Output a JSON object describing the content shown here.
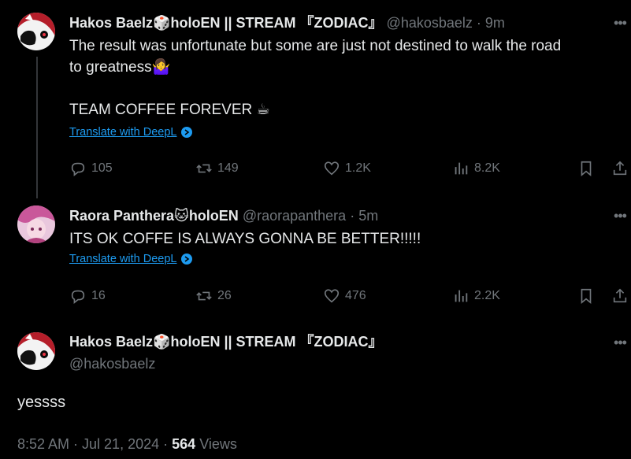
{
  "tweets": [
    {
      "name": "Hakos Baelz🎲holoEN || STREAM 『ZODIAC』",
      "handle": "@hakosbaelz",
      "sep": "·",
      "time": "9m",
      "text1": "The result was unfortunate but some are just not destined to walk the road",
      "text2": "to greatness🤷‍♀️",
      "text3": "TEAM COFFEE FOREVER ☕",
      "translate": "Translate with DeepL",
      "replies": "105",
      "reposts": "149",
      "likes": "1.2K",
      "views": "8.2K"
    },
    {
      "name": "Raora Panthera🐱holoEN",
      "handle": "@raorapanthera",
      "sep": "·",
      "time": "5m",
      "text1": "ITS OK COFFE IS ALWAYS GONNA BE BETTER!!!!!",
      "translate": "Translate with DeepL",
      "replies": "16",
      "reposts": "26",
      "likes": "476",
      "views": "2.2K"
    }
  ],
  "main": {
    "name": "Hakos Baelz🎲holoEN || STREAM 『ZODIAC』",
    "handle": "@hakosbaelz",
    "text": "yessss",
    "time": "8:52 AM · Jul 21, 2024",
    "sep": "·",
    "views_count": "564",
    "views_label": "Views"
  },
  "icons": {
    "more": "more-horizontal-icon",
    "reply": "reply-icon",
    "repost": "repost-icon",
    "like": "heart-icon",
    "views": "views-icon",
    "bookmark": "bookmark-icon",
    "share": "share-icon"
  },
  "colors": {
    "background": "#000000",
    "text": "#e7e9ea",
    "muted": "#71767b",
    "link": "#1d9bf0"
  }
}
